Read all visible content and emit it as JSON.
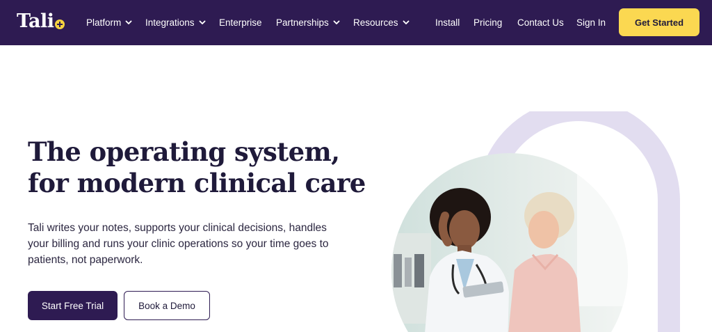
{
  "brand": {
    "name": "Tali",
    "logo_badge": "plus-badge",
    "nav_bg": "#2e1b52",
    "accent": "#fbd851"
  },
  "nav": {
    "items": [
      {
        "label": "Platform",
        "dropdown": true
      },
      {
        "label": "Integrations",
        "dropdown": true
      },
      {
        "label": "Enterprise",
        "dropdown": false
      },
      {
        "label": "Partnerships",
        "dropdown": true
      },
      {
        "label": "Resources",
        "dropdown": true
      },
      {
        "label": "Install",
        "dropdown": false
      },
      {
        "label": "Pricing",
        "dropdown": false
      },
      {
        "label": "Contact Us",
        "dropdown": false
      },
      {
        "label": "Sign In",
        "dropdown": false
      }
    ],
    "cta": "Get Started"
  },
  "hero": {
    "title_line1": "The operating system,",
    "title_line2": "for modern clinical care",
    "subtitle": "Tali writes your notes, supports your clinical decisions, handles your billing and runs your clinic operations so your time goes to patients, not paperwork.",
    "primary_button": "Start Free Trial",
    "secondary_button": "Book a Demo",
    "image_subject": "doctor-consulting-patient-photo"
  }
}
